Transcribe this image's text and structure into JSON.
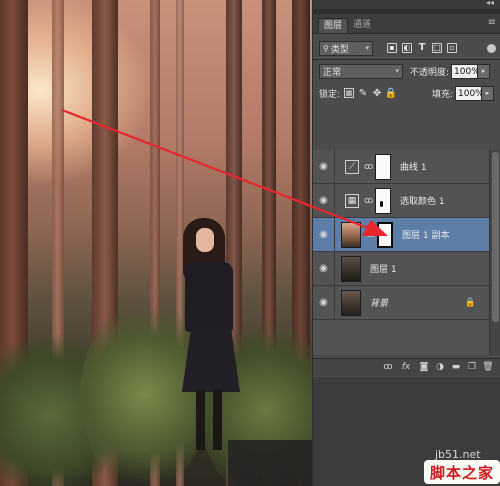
{
  "photo": {
    "alt": ""
  },
  "panel": {
    "collapse_glyph": "◂◂",
    "tabs": [
      {
        "label": "图层",
        "active": true
      },
      {
        "label": "通道",
        "active": false
      }
    ],
    "panel_menu_glyph": "≡",
    "filter": {
      "kind_label": "类型",
      "caret": "▾",
      "icons": [
        "pixel-filter-icon",
        "adjustment-filter-icon",
        "type-filter-icon",
        "shape-filter-icon",
        "smartobject-filter-icon"
      ],
      "type_glyph": "T"
    },
    "blend": {
      "mode": "正常",
      "caret": "▾",
      "opacity_label": "不透明度:",
      "opacity_value": "100%",
      "num_caret": "▸"
    },
    "lock": {
      "label": "锁定:",
      "fill_label": "填充:",
      "fill_value": "100%"
    },
    "layers": [
      {
        "name": "曲线 1",
        "kind": "adjustment",
        "adj_glyph": "⟋",
        "selected": false,
        "locked": false
      },
      {
        "name": "选取颜色 1",
        "kind": "adjustment",
        "adj_glyph": "▦",
        "selected": false,
        "locked": false
      },
      {
        "name": "图层 1 副本",
        "kind": "pixel-with-mask",
        "selected": true,
        "locked": false
      },
      {
        "name": "图层 1",
        "kind": "pixel",
        "selected": false,
        "locked": false
      },
      {
        "name": "背景",
        "kind": "background",
        "selected": false,
        "locked": true
      }
    ],
    "eye_glyph": "◉",
    "link_glyph": "ꝏ",
    "padlock_glyph": "🔒",
    "bottom_icons": [
      "link-layers-icon",
      "fx-icon",
      "add-mask-icon",
      "new-adjustment-icon",
      "new-group-icon",
      "new-layer-icon",
      "delete-layer-icon"
    ],
    "bottom_fx_label": "fx"
  },
  "colors": {
    "panel_bg": "#4b4b4b",
    "selected_row": "#5e7ea8",
    "arrow": "#e8262d",
    "watermark_red": "#d1171d"
  },
  "watermark": {
    "url": "jb51.net",
    "logo": "脚本之家"
  }
}
